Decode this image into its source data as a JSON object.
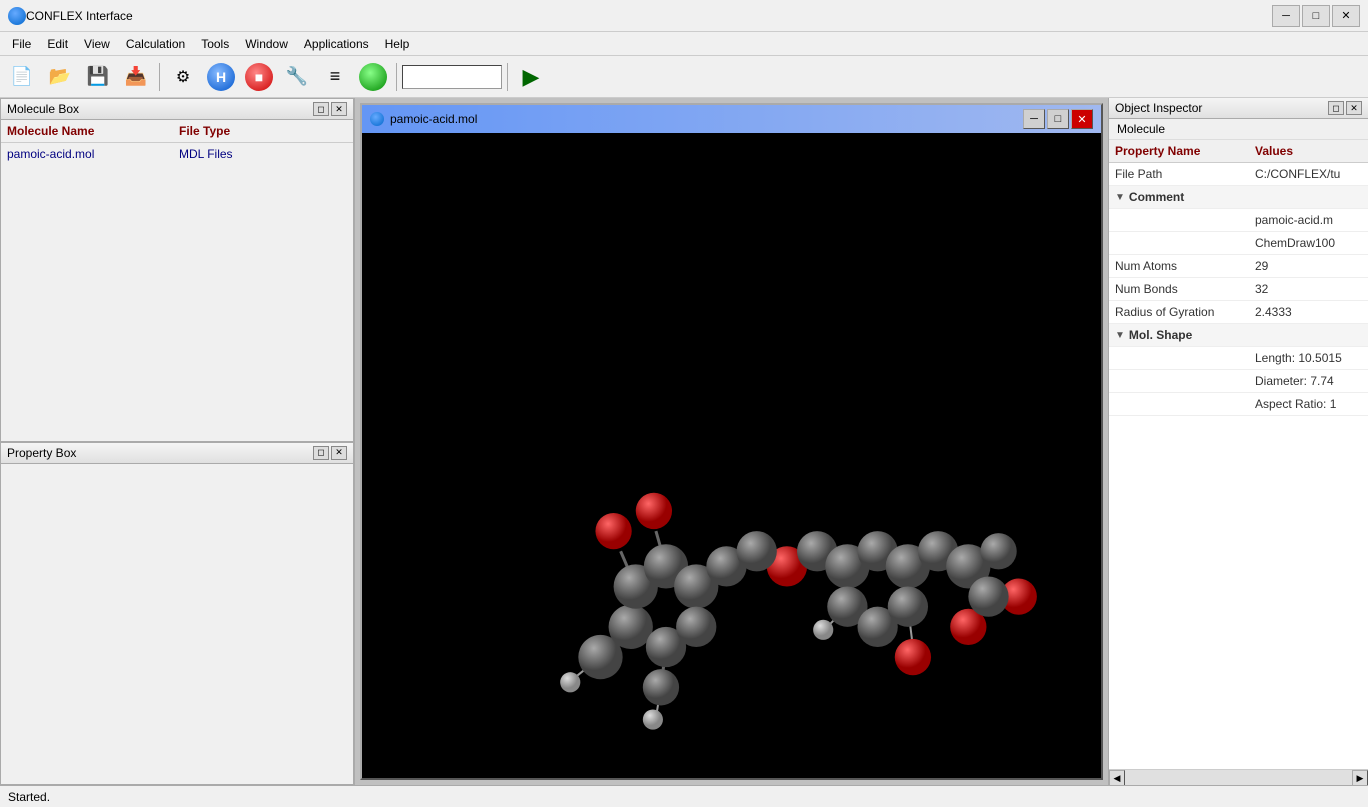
{
  "app": {
    "title": "CONFLEX Interface",
    "icon": "conflex-icon"
  },
  "title_bar": {
    "title": "CONFLEX Interface",
    "minimize_label": "─",
    "maximize_label": "□",
    "close_label": "✕"
  },
  "menu": {
    "items": [
      "File",
      "Edit",
      "View",
      "Calculation",
      "Tools",
      "Window",
      "Applications",
      "Help"
    ]
  },
  "toolbar": {
    "search_placeholder": ""
  },
  "molecule_box": {
    "title": "Molecule Box",
    "columns": [
      "Molecule Name",
      "File Type"
    ],
    "rows": [
      {
        "name": "pamoic-acid.mol",
        "type": "MDL Files"
      }
    ]
  },
  "property_box": {
    "title": "Property Box"
  },
  "mol_window": {
    "title": "pamoic-acid.mol",
    "minimize_label": "─",
    "maximize_label": "□",
    "close_label": "✕"
  },
  "object_inspector": {
    "title": "Object Inspector",
    "subheader": "Molecule",
    "col_property": "Property Name",
    "col_values": "Values",
    "rows": [
      {
        "type": "data",
        "prop": "File Path",
        "val": "C:/CONFLEX/tu"
      },
      {
        "type": "section",
        "prop": "Comment",
        "val": "",
        "expanded": false
      },
      {
        "type": "data",
        "prop": "",
        "val": "pamoic-acid.m"
      },
      {
        "type": "data",
        "prop": "",
        "val": "ChemDraw100"
      },
      {
        "type": "data",
        "prop": "Num Atoms",
        "val": "29"
      },
      {
        "type": "data",
        "prop": "Num Bonds",
        "val": "32"
      },
      {
        "type": "data",
        "prop": "Radius of Gyration",
        "val": "2.4333"
      },
      {
        "type": "section",
        "prop": "Mol. Shape",
        "val": "",
        "expanded": false
      },
      {
        "type": "data",
        "prop": "",
        "val": "Length: 10.5015"
      },
      {
        "type": "data",
        "prop": "",
        "val": "Diameter: 7.74"
      },
      {
        "type": "data",
        "prop": "",
        "val": "Aspect Ratio: 1"
      }
    ]
  },
  "status_bar": {
    "text": "Started."
  },
  "colors": {
    "accent": "#0078d4",
    "molecule_bg": "#000000",
    "atom_carbon": "#808080",
    "atom_oxygen": "#cc0000",
    "header_bg": "#f0f0f0"
  }
}
